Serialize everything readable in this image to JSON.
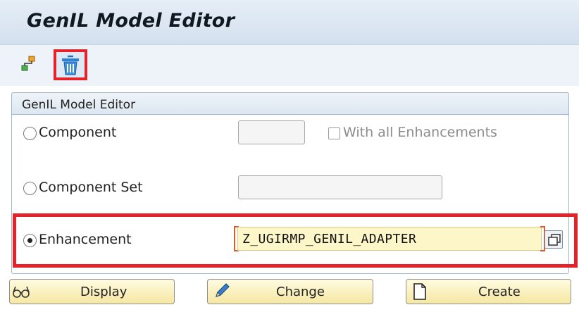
{
  "window": {
    "title": "GenIL Model Editor"
  },
  "toolbar": {
    "icons": [
      "hierarchy-icon",
      "trash-icon"
    ]
  },
  "group": {
    "title": "GenIL Model Editor",
    "options": [
      {
        "label": "Component",
        "selected": false,
        "value": ""
      },
      {
        "label": "Component Set",
        "selected": false,
        "value": ""
      },
      {
        "label": "Enhancement",
        "selected": true,
        "value": "Z_UGIRMP_GENIL_ADAPTER"
      }
    ],
    "with_all_enhancements": {
      "label": "With all Enhancements",
      "checked": false,
      "enabled": false
    }
  },
  "buttons": {
    "display": "Display",
    "change": "Change",
    "create": "Create"
  },
  "colors": {
    "highlight": "#e32329",
    "button_bg": "#f6e7a2",
    "input_bg": "#fdf6c8",
    "header_bg": "#dde7f1"
  }
}
